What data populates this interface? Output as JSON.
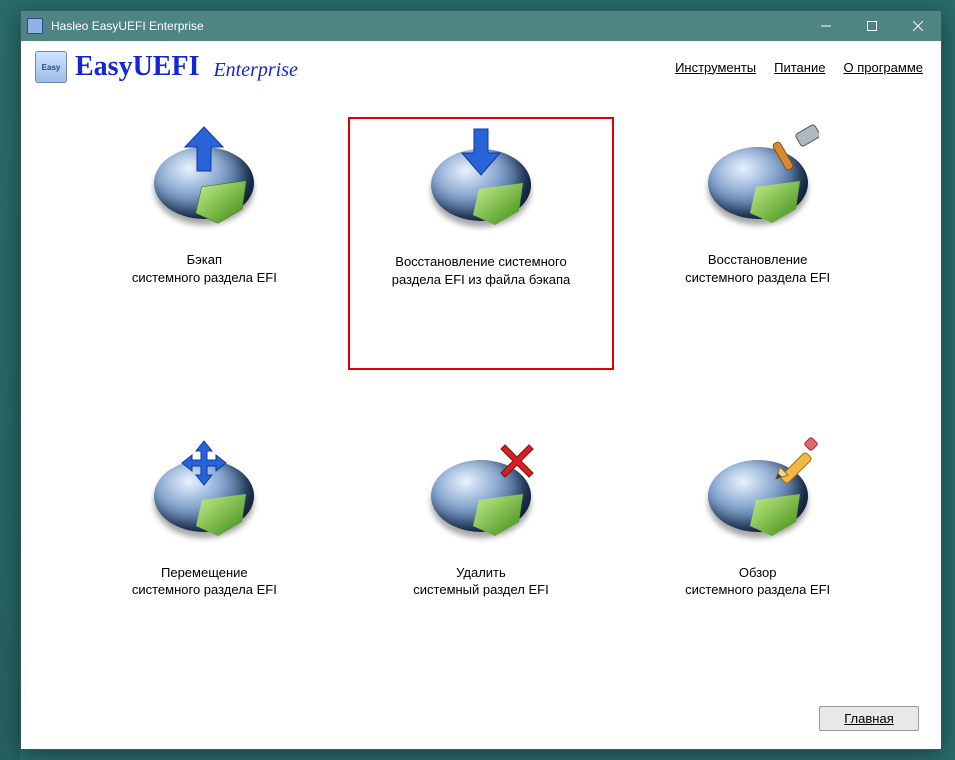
{
  "titlebar": {
    "title": "Hasleo EasyUEFI Enterprise"
  },
  "header": {
    "brand": "EasyUEFI",
    "brand_sub": "Enterprise",
    "menu": {
      "tools": "Инструменты",
      "power": "Питание",
      "about": "О программе"
    }
  },
  "tiles": {
    "backup": {
      "line1": "Бэкап",
      "line2": "системного раздела EFI"
    },
    "restore": {
      "line1": "Восстановление системного",
      "line2": "раздела EFI из файла бэкапа"
    },
    "rebuild": {
      "line1": "Восстановление",
      "line2": "системного раздела EFI"
    },
    "move": {
      "line1": "Перемещение",
      "line2": "системного раздела EFI"
    },
    "delete": {
      "line1": "Удалить",
      "line2": "системный раздел EFI"
    },
    "explore": {
      "line1": "Обзор",
      "line2": "системного раздела EFI"
    }
  },
  "footer": {
    "main_button": "Главная"
  }
}
